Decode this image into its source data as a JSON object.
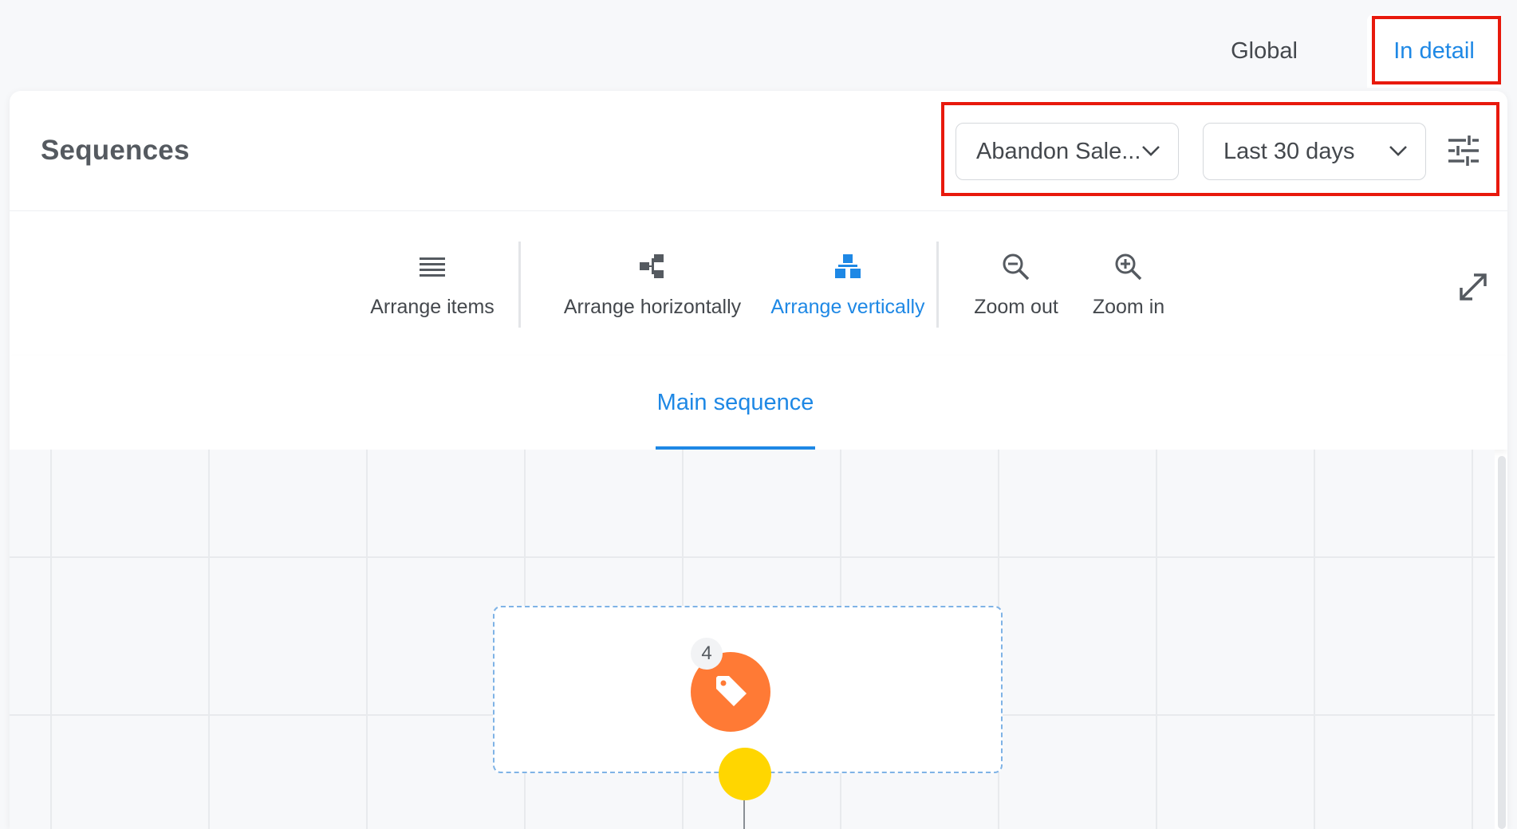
{
  "view_tabs": {
    "global": "Global",
    "in_detail": "In detail"
  },
  "header": {
    "title": "Sequences",
    "sequence_select": "Abandon Sale...",
    "range_select": "Last 30 days"
  },
  "toolbar": {
    "arrange_items": "Arrange items",
    "arrange_horizontally": "Arrange horizontally",
    "arrange_vertically": "Arrange vertically",
    "zoom_out": "Zoom out",
    "zoom_in": "Zoom in"
  },
  "sequence_tabs": {
    "main": "Main sequence"
  },
  "canvas": {
    "node_count": "4"
  },
  "colors": {
    "accent": "#1e88e5",
    "highlight": "#e8190c",
    "node_orange": "#ff7a35",
    "node_yellow": "#ffd600"
  },
  "icons": [
    "filter-sliders-icon",
    "chevron-down-icon",
    "list-icon",
    "hierarchy-horizontal-icon",
    "hierarchy-vertical-icon",
    "zoom-out-icon",
    "zoom-in-icon",
    "expand-icon",
    "tag-icon"
  ]
}
